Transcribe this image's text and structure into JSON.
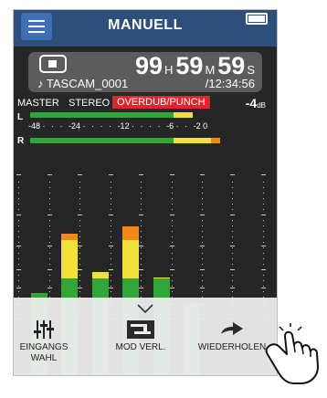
{
  "header": {
    "title": "MANUELL",
    "menu_icon": "hamburger-menu-icon",
    "battery_icon": "battery-icon"
  },
  "status": {
    "transport_icon": "stop-icon",
    "hours": "99",
    "hours_unit": "H",
    "minutes": "59",
    "minutes_unit": "M",
    "seconds": "59",
    "seconds_unit": "S",
    "file_icon": "music-note-icon",
    "file_name": "TASCAM_0001",
    "total_time": "/12:34:56"
  },
  "mode": {
    "master": "MASTER",
    "stereo": "STEREO",
    "overdub": "OVERDUB/PUNCH",
    "level_value": "-4",
    "level_unit": "dB",
    "overdub_color": "#e1242d"
  },
  "stereo_meter": {
    "left_label": "L",
    "right_label": "R",
    "scale": [
      "-48",
      "-24",
      "-12",
      "-6",
      "-2 0"
    ],
    "left_level": 0.7,
    "right_level": 0.82
  },
  "channel_levels": [
    0.32,
    0.55,
    0.4,
    0.58,
    0.38,
    0.28
  ],
  "sheet": {
    "chevron_icon": "chevron-down-icon",
    "buttons": [
      {
        "icon": "input-select-icon",
        "label_line1": "EINGANGS",
        "label_line2": "WAHL"
      },
      {
        "icon": "mode-change-icon",
        "label_line1": "MOD VERL."
      },
      {
        "icon": "arrow-right-icon",
        "label_line1": "WIEDERHOLEN"
      }
    ]
  },
  "colors": {
    "header": "#2d4f7a",
    "menu_button": "#3f6fb6",
    "green": "#2fa636",
    "yellow": "#f0e03a",
    "orange": "#ef8a1a"
  }
}
